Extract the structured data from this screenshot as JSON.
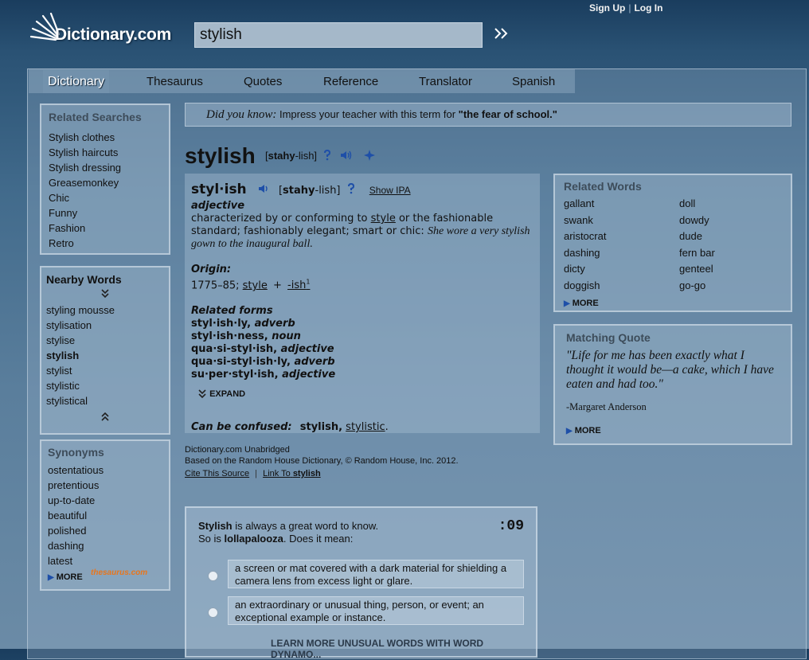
{
  "header": {
    "logo_text": "Dictionary.com",
    "sign_up": "Sign Up",
    "log_in": "Log In",
    "search_value": "stylish",
    "search_go": ">>"
  },
  "nav": [
    "Dictionary",
    "Thesaurus",
    "Quotes",
    "Reference",
    "Translator",
    "Spanish"
  ],
  "related_searches": {
    "title": "Related Searches",
    "items": [
      "Stylish clothes",
      "Stylish haircuts",
      "Stylish dressing",
      "Greasemonkey",
      "Chic",
      "Funny",
      "Fashion",
      "Retro"
    ]
  },
  "nearby_words": {
    "title": "Nearby Words",
    "items": [
      "styling mousse",
      "stylisation",
      "stylise",
      "stylish",
      "stylist",
      "stylistic",
      "stylistical"
    ]
  },
  "synonyms": {
    "title": "Synonyms",
    "items": [
      "ostentatious",
      "pretentious",
      "up-to-date",
      "beautiful",
      "polished",
      "dashing",
      "latest"
    ],
    "more": "MORE",
    "brand": "thesaurus.com"
  },
  "did_you_know": {
    "label": "Did you know:",
    "text": "Impress your teacher with this term for",
    "term": "\"the fear of school.\""
  },
  "entry": {
    "headword": "stylish",
    "pron_open": "[",
    "pron_bold": "stahy",
    "pron_rest": "-lish]",
    "syllabified": "styl·ish",
    "show_ipa": "Show IPA",
    "pos": "adjective",
    "def_1": "characterized by or conforming to",
    "def_link": "style",
    "def_2": " or the fashionable standard; fashionably elegant; smart or chic:",
    "example": "She wore a very stylish gown to the inaugural ball.",
    "origin_label": "Origin:",
    "origin_date": "1775–85;",
    "origin_link1": "style",
    "origin_plus": "+",
    "origin_link2": "-ish",
    "origin_sup": "1",
    "related_label": "Related forms",
    "forms": [
      {
        "word": "styl·ish·ly,",
        "pos": "adverb"
      },
      {
        "word": "styl·ish·ness,",
        "pos": "noun"
      },
      {
        "word": "qua·si-styl·ish,",
        "pos": "adjective"
      },
      {
        "word": "qua·si-styl·ish·ly,",
        "pos": "adverb"
      },
      {
        "word": "su·per·styl·ish,",
        "pos": "adjective"
      }
    ],
    "expand": "EXPAND",
    "confused_label": "Can be confused:",
    "confused_word": "stylish,",
    "confused_link": "stylistic",
    "confused_end": "."
  },
  "source": {
    "line1": "Dictionary.com Unabridged",
    "line2": "Based on the Random House Dictionary, © Random House, Inc. 2012.",
    "cite": "Cite This Source",
    "link_to": "Link To",
    "link_word": "stylish"
  },
  "related_words": {
    "title": "Related Words",
    "col1": [
      "gallant",
      "swank",
      "aristocrat",
      "dashing",
      "dicty",
      "doggish"
    ],
    "col2": [
      "doll",
      "dowdy",
      "dude",
      "fern bar",
      "genteel",
      "go-go"
    ],
    "more": "MORE"
  },
  "matching_quote": {
    "title": "Matching Quote",
    "quote": "\"Life for me has been exactly what I thought it would be—a cake, which I have eaten and had too.\"",
    "author": "-Margaret Anderson",
    "more": "MORE"
  },
  "quiz": {
    "word1": "Stylish",
    "text1": " is always a great word to know.",
    "text2a": "So is ",
    "word2": "lollapalooza",
    "text2b": ". Does it mean:",
    "timer": ":09",
    "options": [
      "a screen or mat covered with a dark material for shielding a camera lens from excess light or glare.",
      "an extraordinary or unusual thing, person, or event; an exceptional example or instance."
    ],
    "learn_more": "LEARN MORE UNUSUAL WORDS WITH WORD DYNAMO..."
  },
  "colors": {
    "accent_blue": "#1e4fa8",
    "brand_orange": "#e8761c"
  }
}
